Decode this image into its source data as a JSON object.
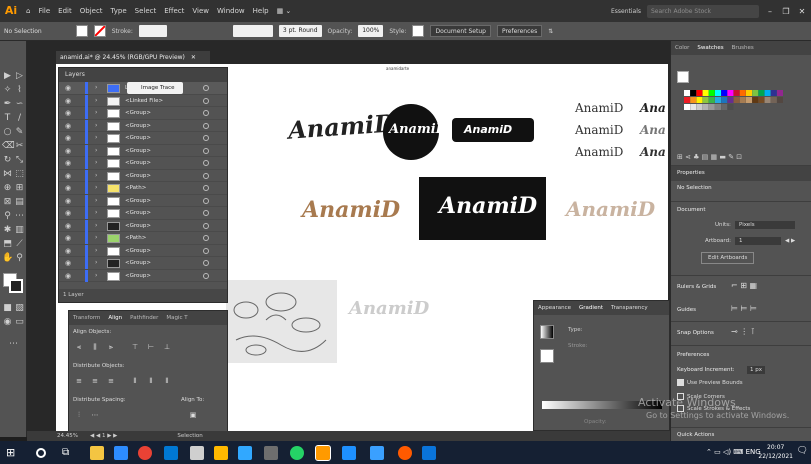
{
  "menubar": {
    "logo": "Ai",
    "items": [
      "File",
      "Edit",
      "Object",
      "Type",
      "Select",
      "Effect",
      "View",
      "Window",
      "Help"
    ],
    "workspace": "Essentials",
    "search_placeholder": "Search Adobe Stock"
  },
  "controlbar": {
    "selection": "No Selection",
    "stroke_label": "Stroke:",
    "brush": "3 pt. Round",
    "opacity_label": "Opacity:",
    "opacity": "100%",
    "style_label": "Style:",
    "doc_setup": "Document Setup",
    "preferences": "Preferences"
  },
  "document": {
    "tab": "anamid.ai* @ 24.45% (RGB/GPU Preview)",
    "artboard_label": "anamidarte"
  },
  "logos": {
    "brand": "AnamiD",
    "brand_alt": "AnamiD"
  },
  "layers_panel": {
    "title": "Layers",
    "image_trace": "Image Trace",
    "rows": [
      {
        "name": "Layer 1"
      },
      {
        "name": "<Linked File>"
      },
      {
        "name": "<Group>"
      },
      {
        "name": "<Group>"
      },
      {
        "name": "<Group>"
      },
      {
        "name": "<Group>"
      },
      {
        "name": "<Group>"
      },
      {
        "name": "<Group>"
      },
      {
        "name": "<Path>"
      },
      {
        "name": "<Group>"
      },
      {
        "name": "<Group>"
      },
      {
        "name": "<Group>"
      },
      {
        "name": "<Path>"
      },
      {
        "name": "<Group>"
      },
      {
        "name": "<Group>"
      },
      {
        "name": "<Group>"
      }
    ],
    "footer": "1 Layer"
  },
  "align_panel": {
    "tabs": [
      "Transform",
      "Align",
      "Pathfinder",
      "Magic T"
    ],
    "align_objects": "Align Objects:",
    "distribute_objects": "Distribute Objects:",
    "distribute_spacing": "Distribute Spacing:",
    "align_to": "Align To:"
  },
  "statusbar": {
    "zoom": "24.45%",
    "tool": "Selection"
  },
  "gradient_panel": {
    "tabs": [
      "Appearance",
      "Gradient",
      "Transparency"
    ],
    "type_label": "Type:",
    "stroke_label": "Stroke:",
    "opacity_label": "Opacity:",
    "location_label": "Location:"
  },
  "right_panel": {
    "tabs": [
      "Color",
      "Swatches",
      "Brushes"
    ],
    "properties": "Properties",
    "no_selection": "No Selection",
    "document": "Document",
    "units_label": "Units:",
    "units_value": "Pixels",
    "artboard_label": "Artboard:",
    "artboard_value": "1",
    "edit_artboards": "Edit Artboards",
    "rulers_grids": "Rulers & Grids",
    "guides": "Guides",
    "snap_options": "Snap Options",
    "preferences": "Preferences",
    "keyboard_increment": "Keyboard Increment:",
    "keyboard_value": "1 px",
    "use_preview_bounds": "Use Preview Bounds",
    "scale_corners": "Scale Corners",
    "scale_strokes": "Scale Strokes & Effects",
    "quick_actions": "Quick Actions"
  },
  "watermark": {
    "line1": "Activate Windows",
    "line2": "Go to Settings to activate Windows."
  },
  "taskbar": {
    "time": "20:07",
    "date": "22/12/2021"
  },
  "colors": {
    "ai_orange": "#ff9a00",
    "panel": "#535353",
    "selection_blue": "#3d6df5",
    "logo_brown": "#a87a4f"
  }
}
